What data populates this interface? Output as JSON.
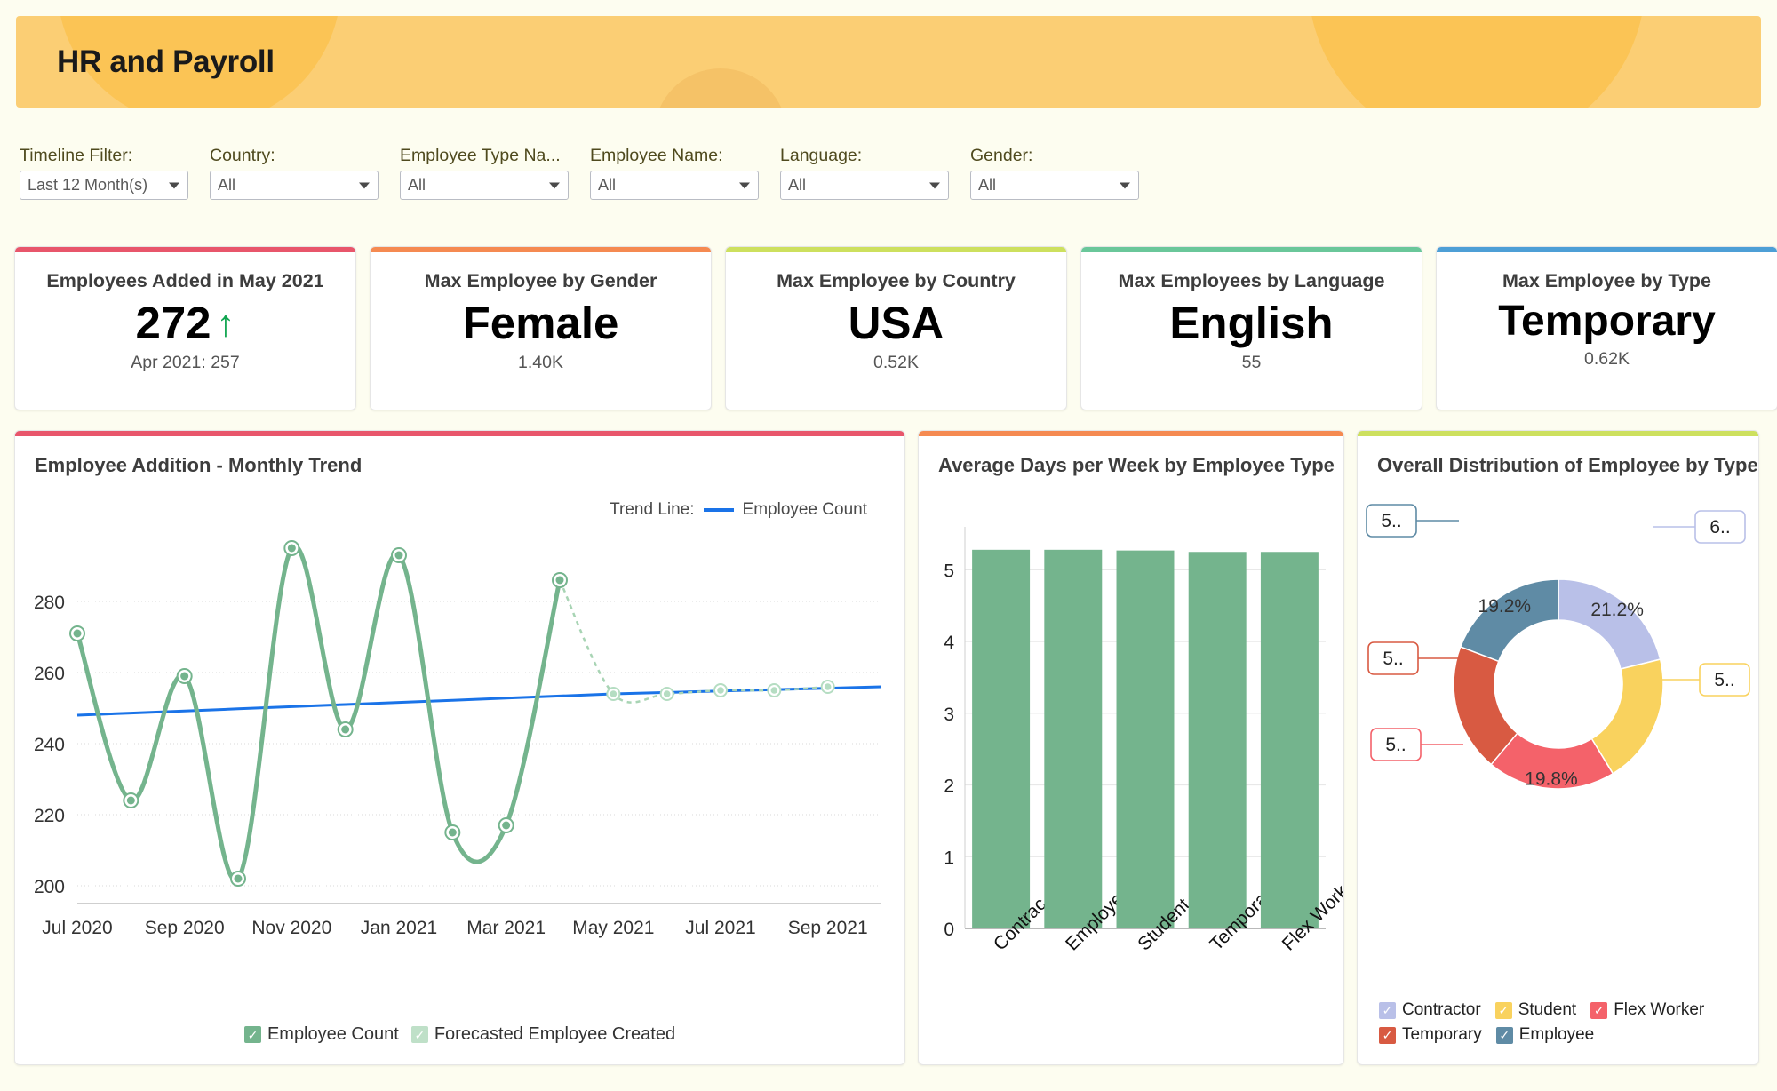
{
  "header": {
    "title": "HR and Payroll",
    "bg_color": "#fbce74"
  },
  "filters": [
    {
      "label": "Timeline Filter:",
      "value": "Last 12 Month(s)",
      "name": "timeline-filter"
    },
    {
      "label": "Country:",
      "value": "All",
      "name": "country-filter"
    },
    {
      "label": "Employee Type Na...",
      "value": "All",
      "name": "employee-type-filter"
    },
    {
      "label": "Employee Name:",
      "value": "All",
      "name": "employee-name-filter"
    },
    {
      "label": "Language:",
      "value": "All",
      "name": "language-filter"
    },
    {
      "label": "Gender:",
      "value": "All",
      "name": "gender-filter"
    }
  ],
  "kpis": [
    {
      "title": "Employees Added in May 2021",
      "value": "272",
      "arrow": "↑",
      "sub": "Apr 2021: 257",
      "accent": "#e8566b"
    },
    {
      "title": "Max Employee by Gender",
      "value": "Female",
      "sub": "1.40K",
      "accent": "#f58a51"
    },
    {
      "title": "Max Employee by Country",
      "value": "USA",
      "sub": "0.52K",
      "accent": "#cde05e"
    },
    {
      "title": "Max Employees by Language",
      "value": "English",
      "sub": "55",
      "accent": "#6dc architecture"
    },
    {
      "title": "Max Employee by Type",
      "value": "Temporary",
      "sub": "0.62K",
      "accent": "#4d9fd6"
    }
  ],
  "panels": {
    "line": {
      "title": "Employee Addition - Monthly Trend",
      "accent": "#e8566b",
      "trend_legend_label": "Trend Line:",
      "trend_legend_series": "Employee Count",
      "legend": [
        {
          "label": "Employee Count",
          "color": "#74b48d"
        },
        {
          "label": "Forecasted Employee Created",
          "color": "#bfe0c8"
        }
      ]
    },
    "bar": {
      "title": "Average Days per Week by Employee Type",
      "accent": "#f58a51"
    },
    "donut": {
      "title": "Overall Distribution of Employee by Type",
      "accent": "#cde05e",
      "callouts": [
        "6..",
        "5..",
        "5..",
        "5..",
        "5.."
      ],
      "legend": [
        {
          "label": "Contractor",
          "color": "#b9c0e8"
        },
        {
          "label": "Student",
          "color": "#f9d25e"
        },
        {
          "label": "Flex Worker",
          "color": "#f4626a"
        },
        {
          "label": "Temporary",
          "color": "#d85a42"
        },
        {
          "label": "Employee",
          "color": "#5f8ba5"
        }
      ]
    }
  },
  "chart_data": [
    {
      "type": "line",
      "title": "Employee Addition - Monthly Trend",
      "xlabel": "",
      "ylabel": "",
      "ylim": [
        195,
        300
      ],
      "yticks": [
        200,
        220,
        240,
        260,
        280
      ],
      "grid": true,
      "legend_position": "bottom",
      "x": [
        "Jul 2020",
        "Aug 2020",
        "Sep 2020",
        "Oct 2020",
        "Nov 2020",
        "Dec 2020",
        "Jan 2021",
        "Feb 2021",
        "Mar 2021",
        "Apr 2021",
        "May 2021",
        "Jun 2021",
        "Jul 2021",
        "Aug 2021",
        "Sep 2021",
        "Oct 2021"
      ],
      "xtick_labels": [
        "Jul 2020",
        "Sep 2020",
        "Nov 2020",
        "Jan 2021",
        "Mar 2021",
        "May 2021",
        "Jul 2021",
        "Sep 2021"
      ],
      "series": [
        {
          "name": "Employee Count",
          "color": "#74b48d",
          "values": [
            271,
            224,
            259,
            202,
            295,
            244,
            293,
            215,
            217,
            286,
            null,
            null,
            null,
            null,
            null,
            null
          ]
        },
        {
          "name": "Forecasted Employee Created",
          "color": "#bfe0c8",
          "values": [
            null,
            null,
            null,
            null,
            null,
            null,
            null,
            null,
            null,
            286,
            254,
            254,
            255,
            255,
            256,
            null
          ]
        },
        {
          "name": "Trend Line",
          "color": "#1a73e8",
          "values": [
            248,
            248.6,
            249.2,
            249.8,
            250.4,
            251,
            251.6,
            252.2,
            252.8,
            253.4,
            254,
            254.4,
            254.8,
            255.2,
            255.6,
            256
          ]
        }
      ]
    },
    {
      "type": "bar",
      "title": "Average Days per Week by Employee Type",
      "categories": [
        "Contrac..",
        "Employee",
        "Student",
        "Temporary",
        "Flex Worker"
      ],
      "values": [
        5.28,
        5.28,
        5.27,
        5.25,
        5.25
      ],
      "color": "#74b48d",
      "ylim": [
        0,
        5.6
      ],
      "yticks": [
        0,
        1,
        2,
        3,
        4,
        5
      ],
      "xlabel": "",
      "ylabel": "",
      "grid": true
    },
    {
      "type": "pie",
      "title": "Overall Distribution of Employee by Type",
      "labels": [
        "Contractor",
        "Student",
        "Flex Worker",
        "Temporary",
        "Employee"
      ],
      "values": [
        21.2,
        20.1,
        19.8,
        19.7,
        19.2
      ],
      "display_labels": [
        "21.2%",
        "",
        "19.8%",
        "",
        "19.2%"
      ],
      "colors": [
        "#b9c0e8",
        "#f9d25e",
        "#f4626a",
        "#d85a42",
        "#5f8ba5"
      ],
      "donut": true,
      "legend_position": "bottom"
    }
  ]
}
